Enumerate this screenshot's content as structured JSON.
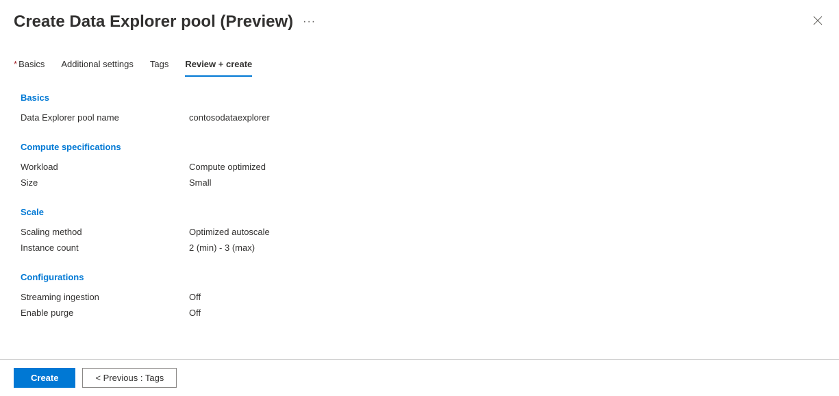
{
  "header": {
    "title": "Create Data Explorer pool (Preview)"
  },
  "tabs": {
    "basics": "Basics",
    "additional": "Additional settings",
    "tags": "Tags",
    "review": "Review + create"
  },
  "sections": {
    "basics": {
      "title": "Basics",
      "pool_name_label": "Data Explorer pool name",
      "pool_name_value": "contosodataexplorer"
    },
    "compute": {
      "title": "Compute specifications",
      "workload_label": "Workload",
      "workload_value": "Compute optimized",
      "size_label": "Size",
      "size_value": "Small"
    },
    "scale": {
      "title": "Scale",
      "method_label": "Scaling method",
      "method_value": "Optimized autoscale",
      "count_label": "Instance count",
      "count_value": "2 (min) - 3 (max)"
    },
    "config": {
      "title": "Configurations",
      "streaming_label": "Streaming ingestion",
      "streaming_value": "Off",
      "purge_label": "Enable purge",
      "purge_value": "Off"
    }
  },
  "footer": {
    "create": "Create",
    "previous": "< Previous : Tags"
  }
}
